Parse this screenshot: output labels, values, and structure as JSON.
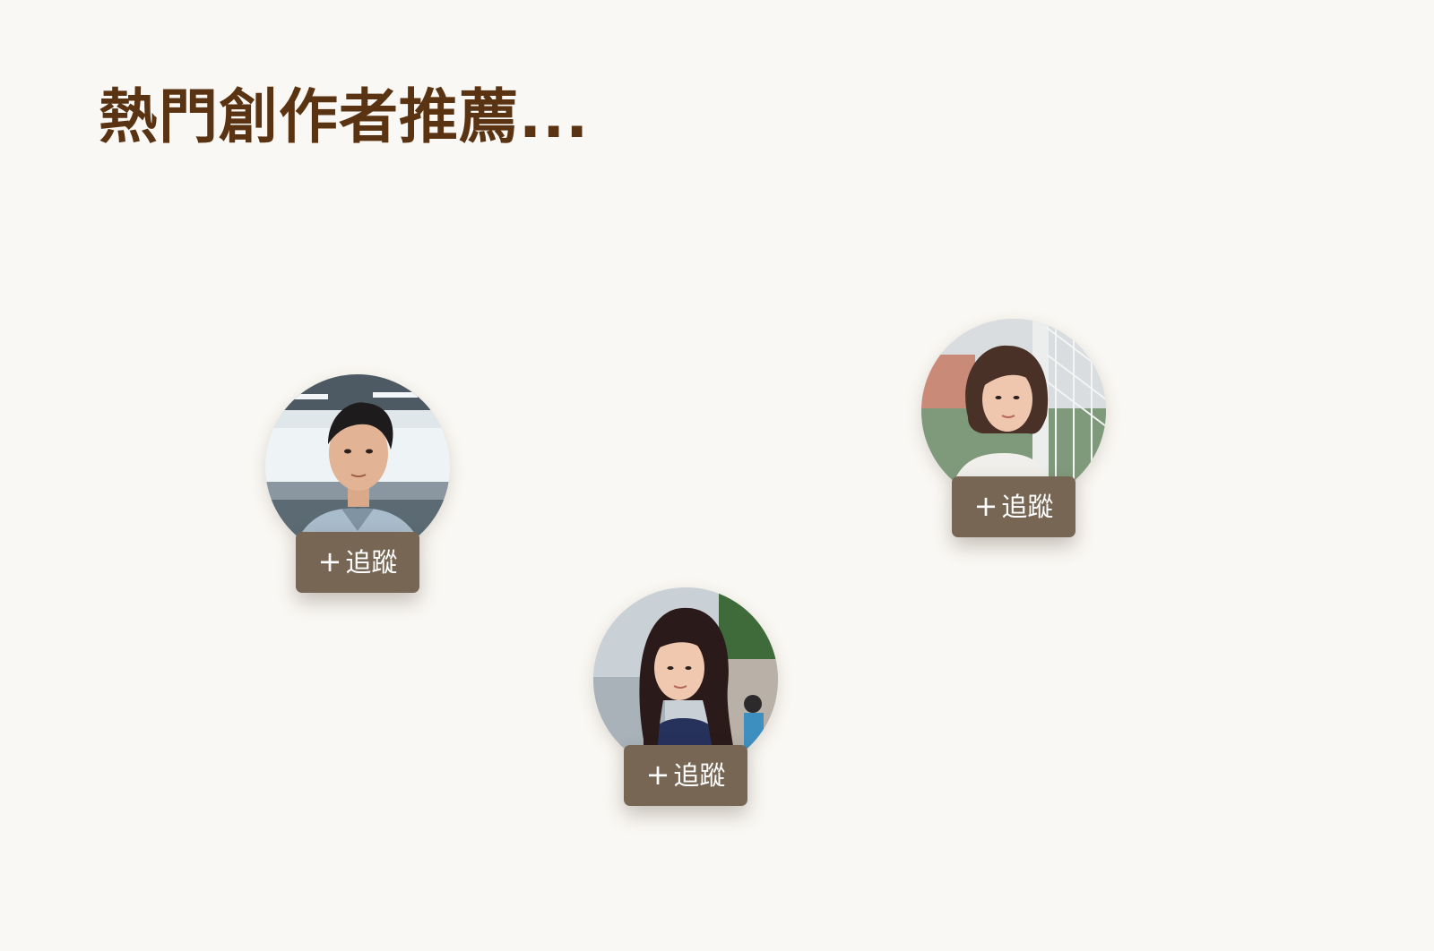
{
  "page": {
    "title": "熱門創作者推薦..."
  },
  "creators": [
    {
      "avatar_icon": "man-portrait-photo",
      "follow": {
        "icon": "plus-icon",
        "label": "追蹤"
      }
    },
    {
      "avatar_icon": "woman-portrait-photo",
      "follow": {
        "icon": "plus-icon",
        "label": "追蹤"
      }
    },
    {
      "avatar_icon": "woman-portrait-photo",
      "follow": {
        "icon": "plus-icon",
        "label": "追蹤"
      }
    }
  ],
  "colors": {
    "background": "#faf8f4",
    "title": "#5a3312",
    "button": "#776654",
    "button_text": "#ffffff"
  }
}
